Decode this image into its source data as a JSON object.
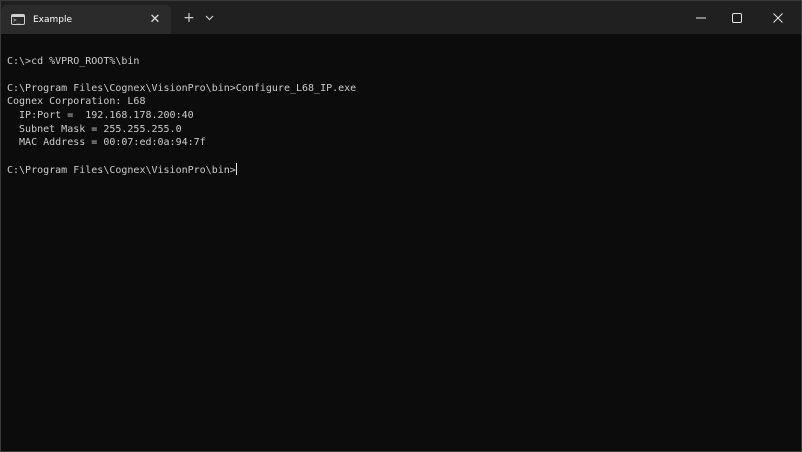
{
  "tab": {
    "title": "Example",
    "close_glyph": "✕",
    "icon": "terminal-icon",
    "icon_prompt": ">_"
  },
  "titlebar": {
    "new_tab_glyph": "+",
    "dropdown_icon": "chevron-down-icon",
    "minimize_icon": "minimize-icon",
    "maximize_icon": "maximize-icon",
    "close_icon": "close-icon"
  },
  "terminal": {
    "lines": [
      "",
      "C:\\>cd %VPRO_ROOT%\\bin",
      "",
      "C:\\Program Files\\Cognex\\VisionPro\\bin>Configure_L68_IP.exe",
      "Cognex Corporation: L68",
      "  IP:Port =  192.168.178.200:40",
      "  Subnet Mask = 255.255.255.0",
      "  MAC Address = 00:07:ed:0a:94:7f",
      "",
      "C:\\Program Files\\Cognex\\VisionPro\\bin>"
    ]
  },
  "colors": {
    "background": "#0c0c0c",
    "titlebar": "#202020",
    "tab": "#2b2b2b",
    "text": "#cccccc"
  }
}
